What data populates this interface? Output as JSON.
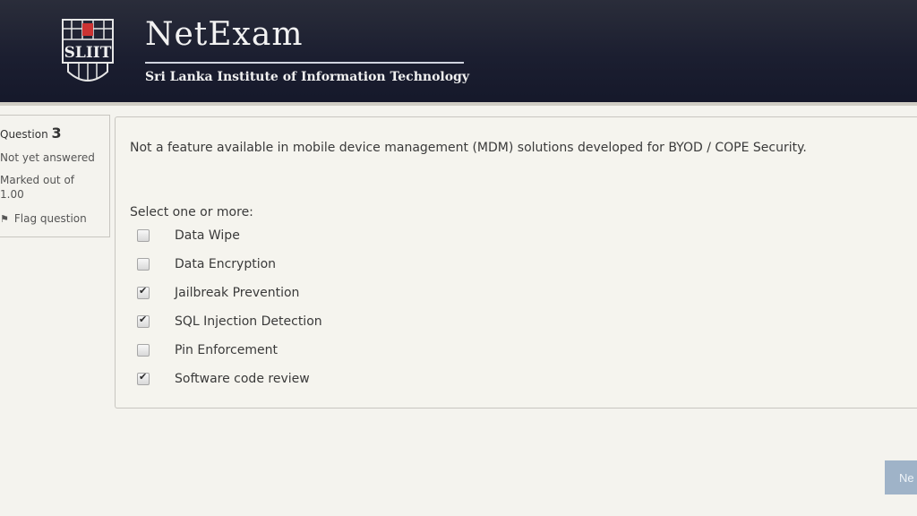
{
  "header": {
    "logo_text": "SLIIT",
    "brand_title": "NetExam",
    "brand_subtitle": "Sri Lanka Institute of Information Technology"
  },
  "question_info": {
    "label": "Question",
    "number": "3",
    "state": "Not yet answered",
    "marked_out_of": "Marked out of 1.00",
    "flag_label": "Flag question"
  },
  "question": {
    "text": "Not a feature available in mobile device management (MDM) solutions developed for BYOD / COPE Security.",
    "prompt": "Select one or more:",
    "options": [
      {
        "label": "Data Wipe",
        "checked": false
      },
      {
        "label": "Data Encryption",
        "checked": false
      },
      {
        "label": "Jailbreak Prevention",
        "checked": true
      },
      {
        "label": "SQL Injection Detection",
        "checked": true
      },
      {
        "label": "Pin Enforcement",
        "checked": false
      },
      {
        "label": "Software code review",
        "checked": true
      }
    ]
  },
  "navigation": {
    "next_label": "Ne"
  },
  "colors": {
    "header_bg": "#1b1e30",
    "next_button": "#9fb3c8"
  }
}
